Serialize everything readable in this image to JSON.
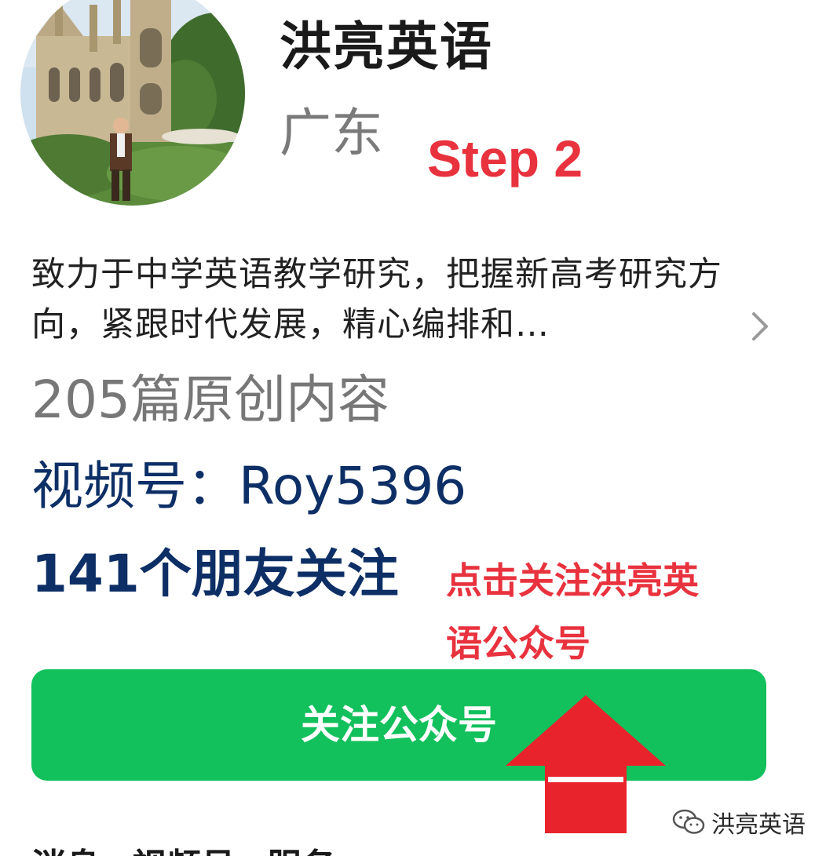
{
  "profile": {
    "account_name": "洪亮英语",
    "region": "广东",
    "avatar_icon": "profile-photo-cathedral"
  },
  "annotations": {
    "step_label": "Step 2",
    "tap_hint": "点击关注洪亮英语公众号",
    "arrow_color": "#e8232c"
  },
  "bio": {
    "text": "致力于中学英语教学研究，把握新高考研究方向，紧跟时代发展，精心编排和…",
    "expand_icon": "chevron-right-icon"
  },
  "stats": {
    "articles": "205篇原创内容",
    "channels_id": "视频号：Roy5396",
    "friends_following": "141个朋友关注"
  },
  "actions": {
    "follow_label": "关注公众号",
    "follow_color": "#12c05c"
  },
  "tabs": [
    "消息",
    "视频号",
    "服务"
  ],
  "watermark": {
    "text": "洪亮英语",
    "icon": "wechat-icon"
  }
}
